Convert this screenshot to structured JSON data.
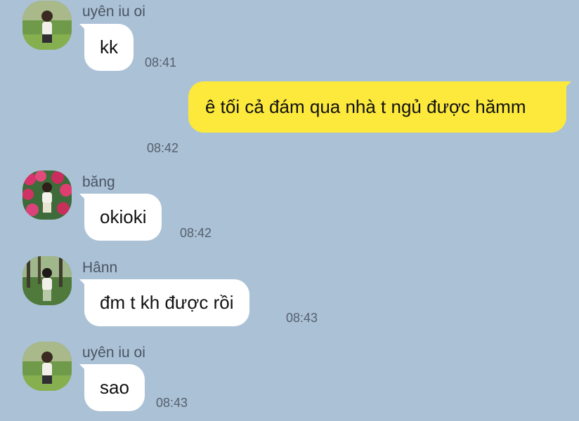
{
  "messages": [
    {
      "type": "in",
      "sender": "uyên iu oi",
      "text": "kk",
      "time": "08:41",
      "avatar": "girl-on-grass-avatar"
    },
    {
      "type": "out",
      "text": "ê tối cả đám qua nhà t ngủ được hămm",
      "time": "08:42"
    },
    {
      "type": "in",
      "sender": "băng",
      "text": "okioki",
      "time": "08:42",
      "avatar": "girl-with-flowers-avatar"
    },
    {
      "type": "in",
      "sender": "Hânn",
      "text": "đm t kh được rồi",
      "time": "08:43",
      "avatar": "girl-in-forest-avatar"
    },
    {
      "type": "in",
      "sender": "uyên iu oi",
      "text": "sao",
      "time": "08:43",
      "avatar": "girl-on-grass-avatar"
    }
  ],
  "colors": {
    "background": "#abc1d6",
    "outgoing_bubble": "#fce93c",
    "incoming_bubble": "#ffffff"
  }
}
